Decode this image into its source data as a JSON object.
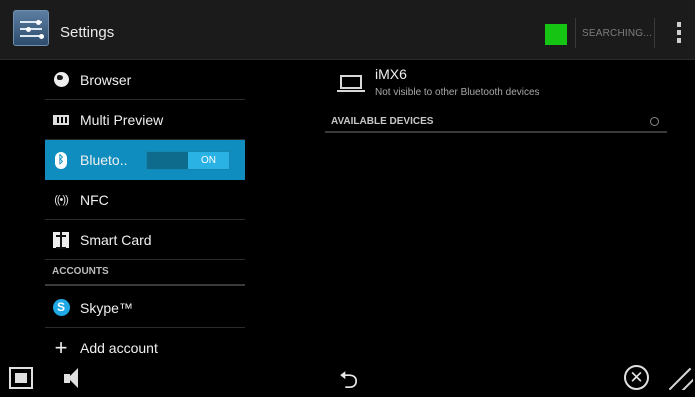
{
  "actionbar": {
    "title": "Settings",
    "status_color": "#16c513",
    "searching_label": "SEARCHING..."
  },
  "sidebar": {
    "items": [
      {
        "label": "Browser",
        "icon": "browser-icon"
      },
      {
        "label": "Multi Preview",
        "icon": "multi-preview-icon"
      },
      {
        "label": "Blueto..",
        "icon": "bluetooth-icon",
        "selected": true,
        "toggle": "ON"
      },
      {
        "label": "NFC",
        "icon": "nfc-icon"
      },
      {
        "label": "Smart Card",
        "icon": "smart-card-icon"
      }
    ],
    "accounts_header": "ACCOUNTS",
    "accounts": [
      {
        "label": "Skype™",
        "icon": "skype-icon"
      },
      {
        "label": "Add account",
        "icon": "plus-icon"
      }
    ]
  },
  "bluetooth": {
    "device_name": "iMX6",
    "device_status": "Not visible to other Bluetooth devices",
    "available_header": "AVAILABLE DEVICES"
  },
  "navbar": {
    "icons": [
      "recent-apps-icon",
      "volume-icon",
      "back-icon",
      "close-icon",
      "resize-icon"
    ]
  },
  "colors": {
    "accent": "#0f8dbe",
    "toggle_on": "#2ab2e4",
    "background": "#000000"
  }
}
